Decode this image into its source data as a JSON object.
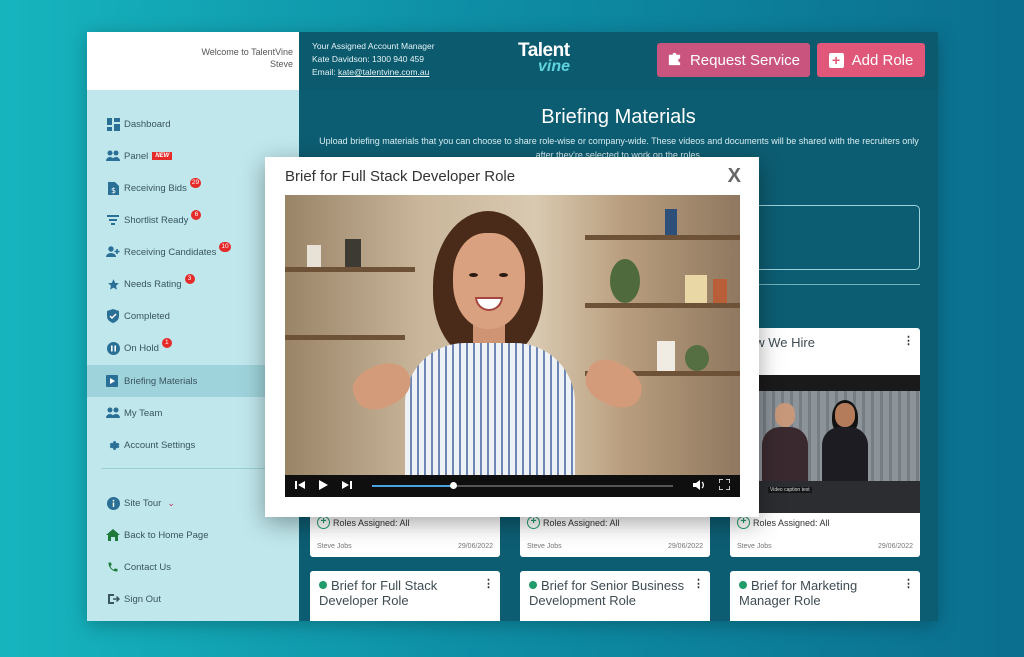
{
  "header": {
    "welcome_line": "Welcome to TalentVine",
    "user_name": "Steve",
    "manager_label": "Your Assigned Account Manager",
    "manager_name_phone": "Kate Davidson: 1300 940 459",
    "email_label": "Email: ",
    "email": "kate@talentvine.com.au",
    "logo_top": "Talent",
    "logo_bottom": "vine",
    "request_service_label": "Request Service",
    "add_role_label": "Add Role"
  },
  "sidebar": {
    "items": [
      {
        "label": "Dashboard",
        "icon": "dashboard-icon"
      },
      {
        "label": "Panel",
        "icon": "users-icon",
        "tag": "NEW"
      },
      {
        "label": "Receiving Bids",
        "icon": "dollar-doc-icon",
        "badge": "29"
      },
      {
        "label": "Shortlist Ready",
        "icon": "filter-icon",
        "badge": "6"
      },
      {
        "label": "Receiving Candidates",
        "icon": "user-plus-icon",
        "badge": "10"
      },
      {
        "label": "Needs Rating",
        "icon": "star-icon",
        "badge": "3"
      },
      {
        "label": "Completed",
        "icon": "shield-check-icon"
      },
      {
        "label": "On Hold",
        "icon": "pause-icon",
        "badge": "1"
      },
      {
        "label": "Briefing Materials",
        "icon": "video-icon"
      },
      {
        "label": "My Team",
        "icon": "team-icon"
      },
      {
        "label": "Account Settings",
        "icon": "gear-icon"
      }
    ],
    "footer_items": [
      {
        "label": "Site Tour",
        "icon": "info-icon"
      },
      {
        "label": "Back to Home Page",
        "icon": "home-icon"
      },
      {
        "label": "Contact Us",
        "icon": "phone-icon"
      },
      {
        "label": "Sign Out",
        "icon": "sign-out-icon"
      }
    ]
  },
  "main": {
    "title": "Briefing Materials",
    "description": "Upload briefing materials that you can choose to share role-wise or company-wide. These videos and documents will be shared with the recruiters only after they're selected to work on the roles."
  },
  "cards_top": {
    "partial_title": "ow We Hire",
    "thumb_caption": "Video caption text",
    "roles": [
      {
        "label": "Roles Assigned: All",
        "author": "Steve Jobs",
        "date": "29/06/2022"
      },
      {
        "label": "Roles Assigned: All",
        "author": "Steve Jobs",
        "date": "29/06/2022"
      },
      {
        "label": "Roles Assigned: All",
        "author": "Steve Jobs",
        "date": "29/06/2022"
      }
    ]
  },
  "cards_bottom": [
    {
      "title": "Brief for Full Stack Developer Role"
    },
    {
      "title": "Brief for Senior Business Development Role"
    },
    {
      "title": "Brief for Marketing Manager Role"
    }
  ],
  "modal": {
    "title": "Brief for Full Stack Developer Role",
    "close_glyph": "X",
    "video_progress": 0.27
  },
  "colors": {
    "accent_pink": "#e0577a",
    "request_pink": "#c9547d",
    "sidebar_bg": "#bfe7ec",
    "main_bg": "#0d5d72",
    "icon_blue": "#2a6f95",
    "badge_red": "#e52a2a",
    "green": "#1f9c6a"
  }
}
